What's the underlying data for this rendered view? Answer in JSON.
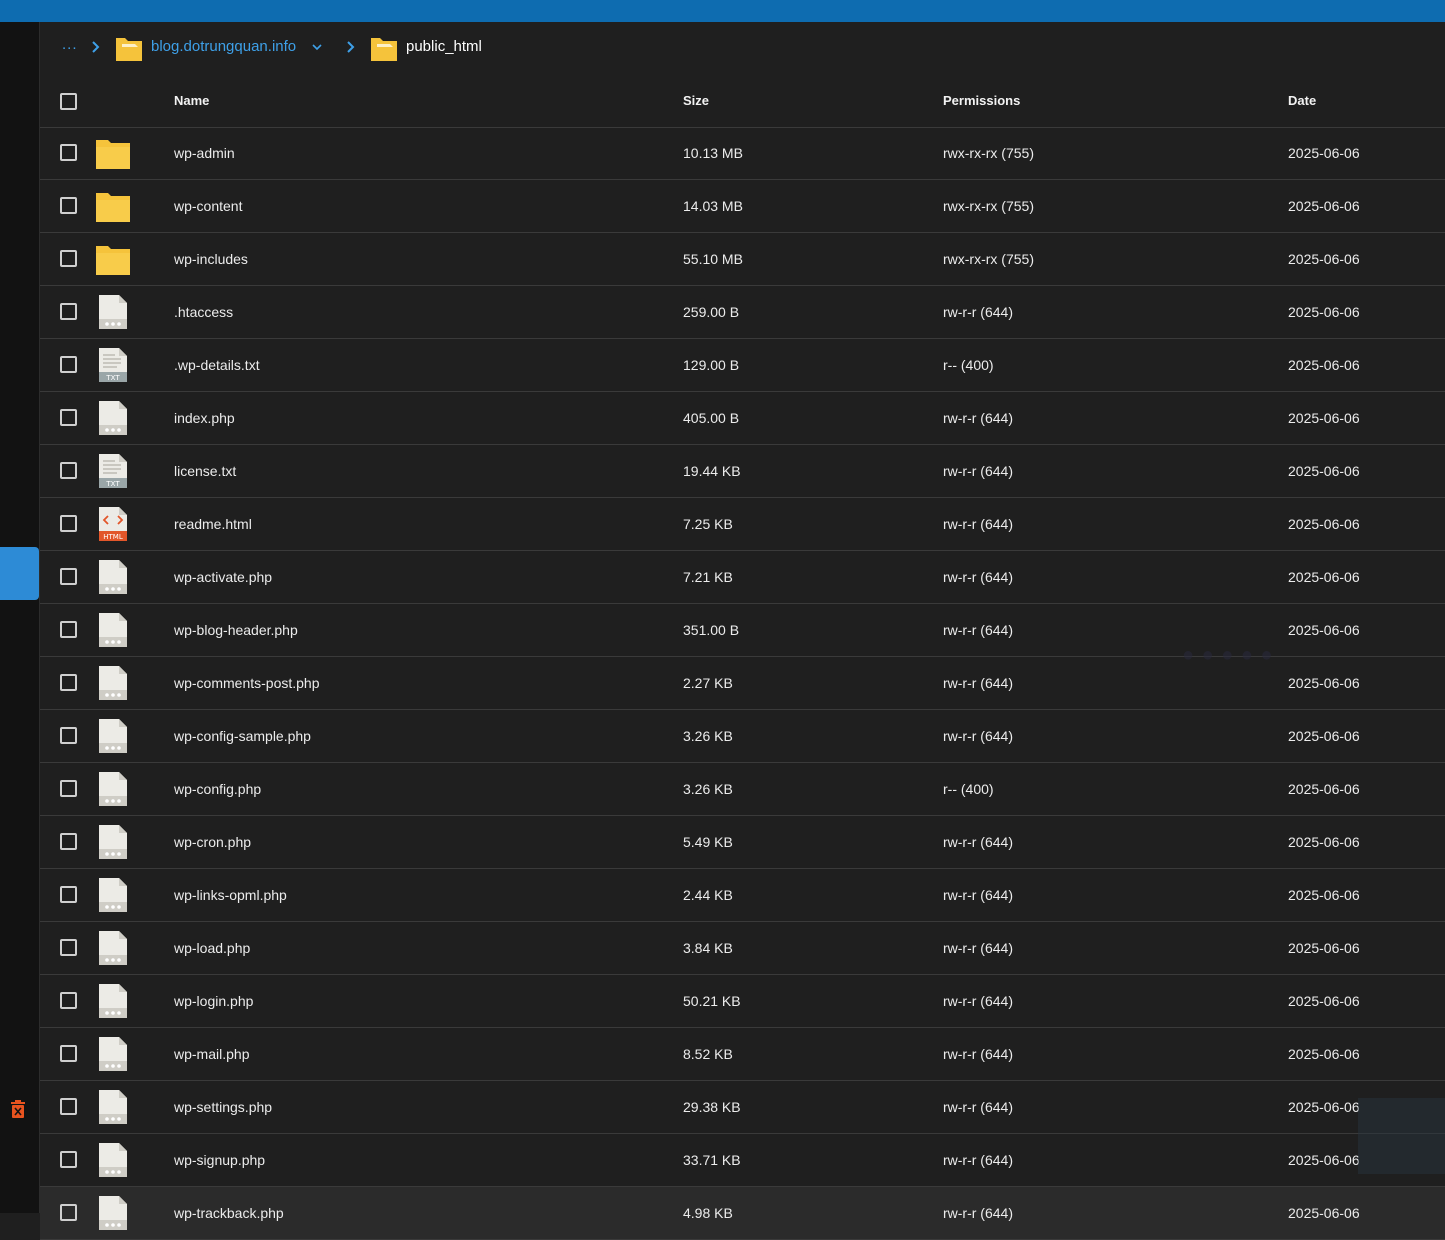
{
  "breadcrumb": {
    "ellipsis": "...",
    "domain": "blog.dotrungquan.info",
    "current": "public_html"
  },
  "columns": {
    "name": "Name",
    "size": "Size",
    "permissions": "Permissions",
    "date": "Date"
  },
  "files": [
    {
      "name": "wp-admin",
      "size": "10.13 MB",
      "permissions": "rwx-rx-rx (755)",
      "date": "2025-06-06",
      "icon": "folder-icon"
    },
    {
      "name": "wp-content",
      "size": "14.03 MB",
      "permissions": "rwx-rx-rx (755)",
      "date": "2025-06-06",
      "icon": "folder-icon"
    },
    {
      "name": "wp-includes",
      "size": "55.10 MB",
      "permissions": "rwx-rx-rx (755)",
      "date": "2025-06-06",
      "icon": "folder-icon"
    },
    {
      "name": ".htaccess",
      "size": "259.00 B",
      "permissions": "rw-r-r (644)",
      "date": "2025-06-06",
      "icon": "file-icon"
    },
    {
      "name": ".wp-details.txt",
      "size": "129.00 B",
      "permissions": "r-- (400)",
      "date": "2025-06-06",
      "icon": "txt-file-icon"
    },
    {
      "name": "index.php",
      "size": "405.00 B",
      "permissions": "rw-r-r (644)",
      "date": "2025-06-06",
      "icon": "file-icon"
    },
    {
      "name": "license.txt",
      "size": "19.44 KB",
      "permissions": "rw-r-r (644)",
      "date": "2025-06-06",
      "icon": "txt-file-icon"
    },
    {
      "name": "readme.html",
      "size": "7.25 KB",
      "permissions": "rw-r-r (644)",
      "date": "2025-06-06",
      "icon": "html-file-icon"
    },
    {
      "name": "wp-activate.php",
      "size": "7.21 KB",
      "permissions": "rw-r-r (644)",
      "date": "2025-06-06",
      "icon": "file-icon"
    },
    {
      "name": "wp-blog-header.php",
      "size": "351.00 B",
      "permissions": "rw-r-r (644)",
      "date": "2025-06-06",
      "icon": "file-icon"
    },
    {
      "name": "wp-comments-post.php",
      "size": "2.27 KB",
      "permissions": "rw-r-r (644)",
      "date": "2025-06-06",
      "icon": "file-icon"
    },
    {
      "name": "wp-config-sample.php",
      "size": "3.26 KB",
      "permissions": "rw-r-r (644)",
      "date": "2025-06-06",
      "icon": "file-icon"
    },
    {
      "name": "wp-config.php",
      "size": "3.26 KB",
      "permissions": "r-- (400)",
      "date": "2025-06-06",
      "icon": "file-icon"
    },
    {
      "name": "wp-cron.php",
      "size": "5.49 KB",
      "permissions": "rw-r-r (644)",
      "date": "2025-06-06",
      "icon": "file-icon"
    },
    {
      "name": "wp-links-opml.php",
      "size": "2.44 KB",
      "permissions": "rw-r-r (644)",
      "date": "2025-06-06",
      "icon": "file-icon"
    },
    {
      "name": "wp-load.php",
      "size": "3.84 KB",
      "permissions": "rw-r-r (644)",
      "date": "2025-06-06",
      "icon": "file-icon"
    },
    {
      "name": "wp-login.php",
      "size": "50.21 KB",
      "permissions": "rw-r-r (644)",
      "date": "2025-06-06",
      "icon": "file-icon"
    },
    {
      "name": "wp-mail.php",
      "size": "8.52 KB",
      "permissions": "rw-r-r (644)",
      "date": "2025-06-06",
      "icon": "file-icon"
    },
    {
      "name": "wp-settings.php",
      "size": "29.38 KB",
      "permissions": "rw-r-r (644)",
      "date": "2025-06-06",
      "icon": "file-icon"
    },
    {
      "name": "wp-signup.php",
      "size": "33.71 KB",
      "permissions": "rw-r-r (644)",
      "date": "2025-06-06",
      "icon": "file-icon"
    },
    {
      "name": "wp-trackback.php",
      "size": "4.98 KB",
      "permissions": "rw-r-r (644)",
      "date": "2025-06-06",
      "icon": "file-icon"
    }
  ],
  "colors": {
    "topbar": "#0e6cb0",
    "accent": "#3ea0e8",
    "folder": "#f5c33b",
    "html_badge": "#e2562a",
    "trash": "#e8531f"
  }
}
